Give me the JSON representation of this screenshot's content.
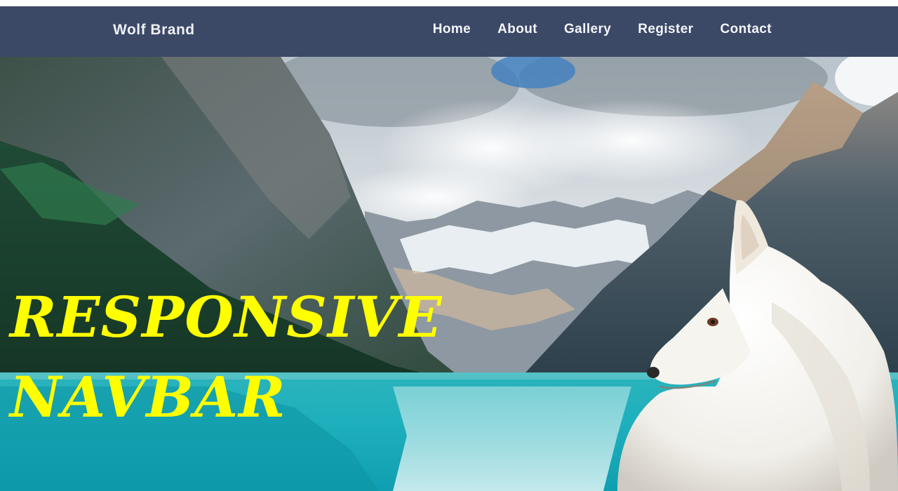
{
  "navbar": {
    "brand": "Wolf Brand",
    "links": [
      {
        "label": "Home"
      },
      {
        "label": "About"
      },
      {
        "label": "Gallery"
      },
      {
        "label": "Register"
      },
      {
        "label": "Contact"
      }
    ],
    "background_color": "#3b4866"
  },
  "hero": {
    "headline_line1": "RESPONSIVE",
    "headline_line2": "NAVBAR",
    "headline_color": "#ffff00",
    "image": "mountain lake with white dog"
  }
}
